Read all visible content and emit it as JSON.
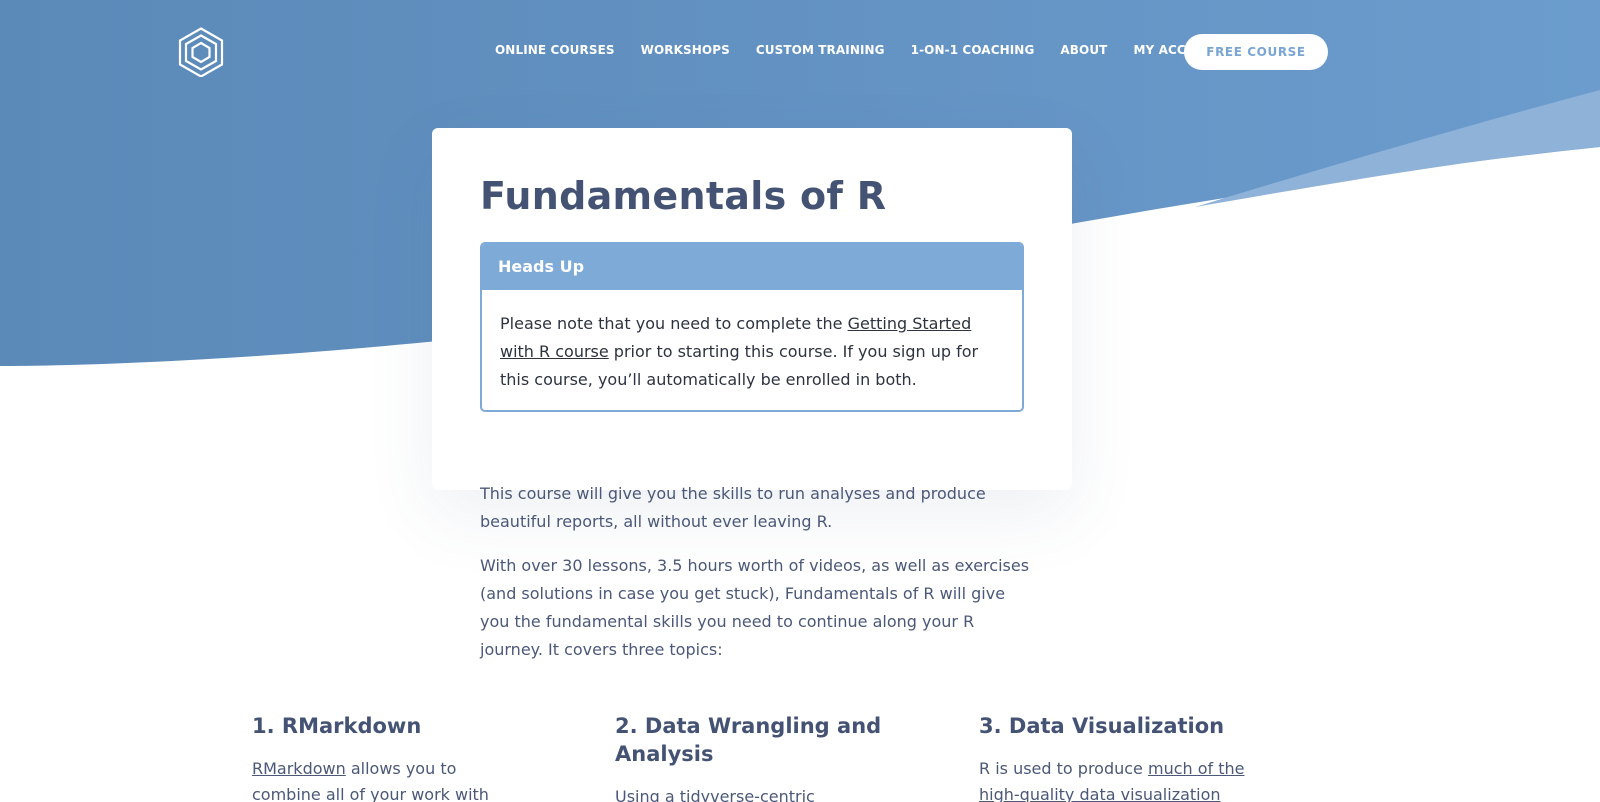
{
  "colors": {
    "hero_blue": "#5e8dbd",
    "hero_blue_light": "#8fb2d9",
    "alert_blue": "#7eaad8",
    "heading": "#445274",
    "text": "#4b5878",
    "button_text": "#7aa5d3"
  },
  "header": {
    "logo_icon": "hexagon-logo-icon",
    "nav": [
      {
        "label": "ONLINE COURSES"
      },
      {
        "label": "WORKSHOPS"
      },
      {
        "label": "CUSTOM TRAINING"
      },
      {
        "label": "1-ON-1 COACHING"
      },
      {
        "label": "ABOUT"
      },
      {
        "label": "MY ACCOUNT"
      }
    ],
    "cta_label": "FREE COURSE"
  },
  "card": {
    "title": "Fundamentals of R",
    "alert": {
      "title": "Heads Up",
      "text_before": "Please note that you need to complete the ",
      "link": "Getting Started with R course",
      "text_after": " prior to starting this course. If you sign up for this course, you’ll automatically be enrolled in both."
    }
  },
  "intro": [
    "This course will give you the skills to run analyses and produce beautiful reports, all without ever leaving R.",
    "With over 30 lessons, 3.5 hours worth of videos, as well as exercises (and solutions in case you get stuck), Fundamentals of R will give you the fundamental skills you need to continue along your R journey. It covers three topics:"
  ],
  "topics": [
    {
      "heading": "1. RMarkdown",
      "link": "RMarkdown",
      "text": " allows you to combine all of your work with"
    },
    {
      "heading": "2. Data Wrangling and Analysis",
      "text_before": "Using a ",
      "link": "tidyverse-centric"
    },
    {
      "heading": "3. Data Visualization",
      "text_before": "R is used to produce ",
      "link": "much of the high-quality data visualization"
    }
  ]
}
